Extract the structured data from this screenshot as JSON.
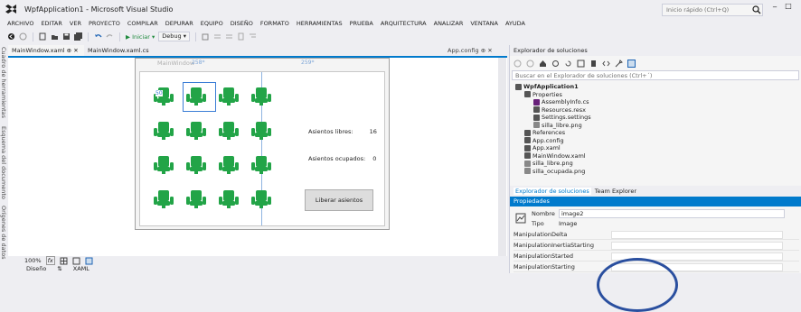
{
  "window": {
    "title": "WpfApplication1 - Microsoft Visual Studio",
    "quick_launch_placeholder": "Inicio rápido (Ctrl+Q)",
    "min_glyph": "‒",
    "max_glyph": "□"
  },
  "menu": [
    "ARCHIVO",
    "EDITAR",
    "VER",
    "PROYECTO",
    "COMPILAR",
    "DEPURAR",
    "EQUIPO",
    "DISEÑO",
    "FORMATO",
    "HERRAMIENTAS",
    "PRUEBA",
    "ARQUITECTURA",
    "ANALIZAR",
    "VENTANA",
    "AYUDA"
  ],
  "toolbar": {
    "start_label": "▶ Iniciar ▾",
    "config_label": "Debug",
    "config_arrow": "▾"
  },
  "left_strip": [
    "Cuadro de herramientas",
    "Esquema del documento",
    "Orígenes de datos"
  ],
  "doc_tabs": {
    "xaml": "MainWindow.xaml",
    "xaml_pin": "⊕",
    "xaml_close": "✕",
    "cs": "MainWindow.xaml.cs",
    "app_config": "App.config",
    "app_config_pin": "⊕",
    "app_config_close": "✕"
  },
  "designer": {
    "window_title": "MainWindow",
    "dim_left": "258*",
    "dim_right": "259*",
    "selection_label": "50",
    "libres_label": "Asientos libres:",
    "libres_value": "16",
    "ocupados_label": "Asientos ocupados:",
    "ocupados_value": "0",
    "release_button": "Liberar asientos",
    "seat_color": "#22a447",
    "grid_color": "#8fb4e0",
    "selection_color": "#3a7dd6",
    "seat_count": 16
  },
  "zoombar": {
    "zoom": "100%",
    "fx": "fx"
  },
  "bottom_tabs": [
    "Diseño",
    "⇅",
    "XAML"
  ],
  "solution_explorer": {
    "title": "Explorador de soluciones",
    "search_placeholder": "Buscar en el Explorador de soluciones (Ctrl+´)",
    "items": [
      {
        "label": "WpfApplication1",
        "bold": true,
        "depth": 0,
        "icon": "project-icon"
      },
      {
        "label": "Properties",
        "depth": 1,
        "icon": "folder-icon"
      },
      {
        "label": "AssemblyInfo.cs",
        "depth": 2,
        "icon": "csharp-icon",
        "prefix": "C#"
      },
      {
        "label": "Resources.resx",
        "depth": 2,
        "icon": "resource-icon"
      },
      {
        "label": "Settings.settings",
        "depth": 2,
        "icon": "gear-icon"
      },
      {
        "label": "silla_libre.png",
        "depth": 2,
        "icon": "image-icon"
      },
      {
        "label": "References",
        "depth": 1,
        "icon": "references-icon"
      },
      {
        "label": "App.config",
        "depth": 1,
        "icon": "config-icon"
      },
      {
        "label": "App.xaml",
        "depth": 1,
        "icon": "xaml-icon"
      },
      {
        "label": "MainWindow.xaml",
        "depth": 1,
        "icon": "xaml-icon"
      },
      {
        "label": "silla_libre.png",
        "depth": 1,
        "icon": "image-icon"
      },
      {
        "label": "silla_ocupada.png",
        "depth": 1,
        "icon": "image-icon"
      }
    ],
    "tab_active": "Explorador de soluciones",
    "tab_other": "Team Explorer"
  },
  "properties": {
    "title": "Propiedades",
    "name_label": "Nombre",
    "name_value": "image2",
    "type_label": "Tipo",
    "type_value": "Image",
    "rows": [
      "ManipulationDelta",
      "ManipulationInertiaStarting",
      "ManipulationStarted",
      "ManipulationStarting"
    ]
  },
  "colors": {
    "accent": "#007acc",
    "seat": "#22a447"
  }
}
